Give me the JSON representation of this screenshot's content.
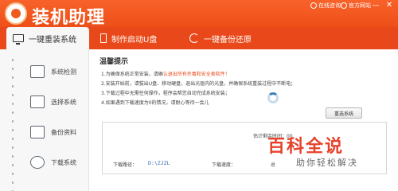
{
  "app": {
    "title": "装机助理"
  },
  "window": {
    "online_consult": "在线咨询",
    "official_forum": "官方网站",
    "minimize": "—",
    "close": "✕"
  },
  "tabs": [
    {
      "label": "一键重装系统",
      "icon": "monitor-icon",
      "active": true
    },
    {
      "label": "制作启动U盘",
      "icon": "usb-drive-icon",
      "active": false
    },
    {
      "label": "一键备份还原",
      "icon": "backup-restore-icon",
      "active": false
    }
  ],
  "steps": [
    {
      "label": "系统检测",
      "icon": "system-check-icon"
    },
    {
      "label": "选择系统",
      "icon": "select-system-icon"
    },
    {
      "label": "备份资料",
      "icon": "backup-data-icon"
    },
    {
      "label": "下载系统",
      "icon": "download-icon"
    }
  ],
  "tips": {
    "title": "温馨提示",
    "line1_prefix": "1.为确保系统正常安装，请确",
    "line1_highlight": "认退出所有杀毒和安全类软件！",
    "line2": "2.安装开始前，请拔出U盘、移动硬盘，退出光驱内的光盘，并确保系统重装过程中不断电；",
    "line3": "3.下载过程中无需任何操作，程序会帮您自动完成系统安装；",
    "line4": "4.如果遇到下载速度为0的情况，请耐心等待一会儿"
  },
  "actions": {
    "reselect": "重选系统"
  },
  "download": {
    "eta_label": "估计剩余时间：00",
    "path_label": "下载路径：",
    "path_value": "D:\\ZJZL",
    "speed_label": "下载速度：",
    "total_label": "总"
  },
  "watermark": {
    "main": "百科全说",
    "sub": "助你轻松解决"
  },
  "colors": {
    "brand": "#ee4f18",
    "highlight": "#e94a1b",
    "link": "#2f66b0"
  }
}
